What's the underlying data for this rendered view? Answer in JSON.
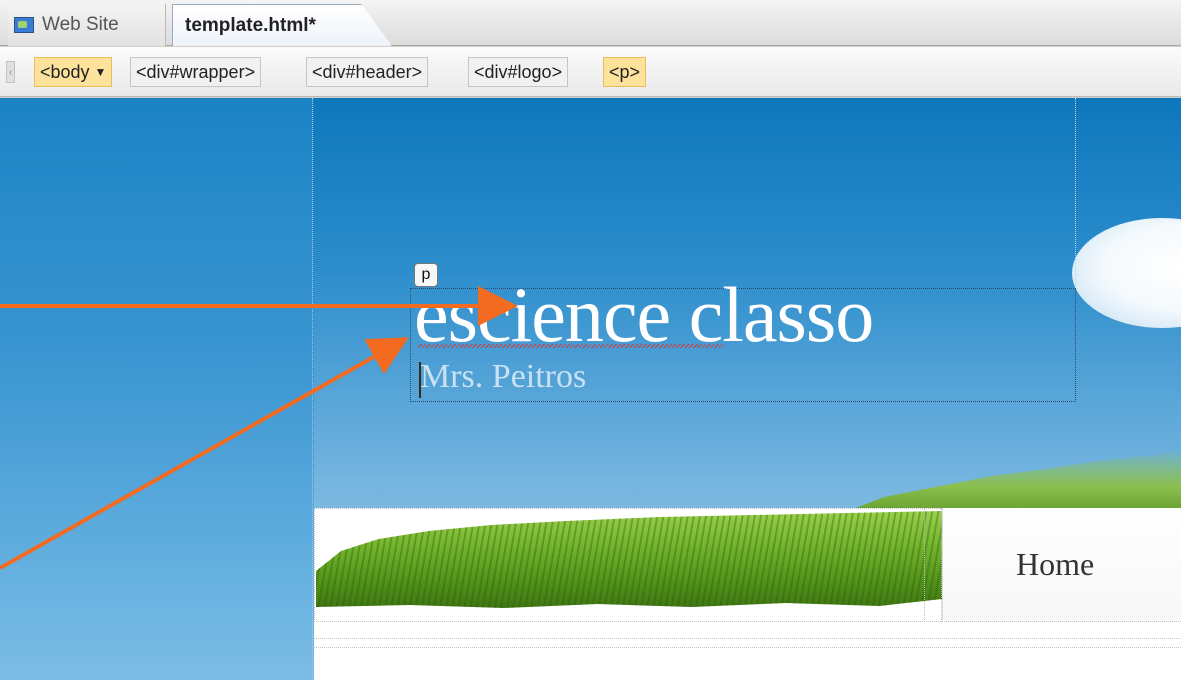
{
  "tabs": [
    {
      "label": "Web Site",
      "icon": "website-icon",
      "active": false
    },
    {
      "label": "template.html*",
      "active": true
    }
  ],
  "tag_selector": {
    "tags": [
      "<body",
      "<div#wrapper>",
      "<div#header>",
      "<div#logo>",
      "<p>"
    ],
    "highlight_color": "#fde29b"
  },
  "design_view": {
    "element_marker": "p",
    "site_title": "escience classo",
    "site_subtitle": "Mrs. Peitros",
    "nav": {
      "home_label": "Home"
    }
  },
  "annotation": {
    "arrow_color": "#f26b21"
  }
}
